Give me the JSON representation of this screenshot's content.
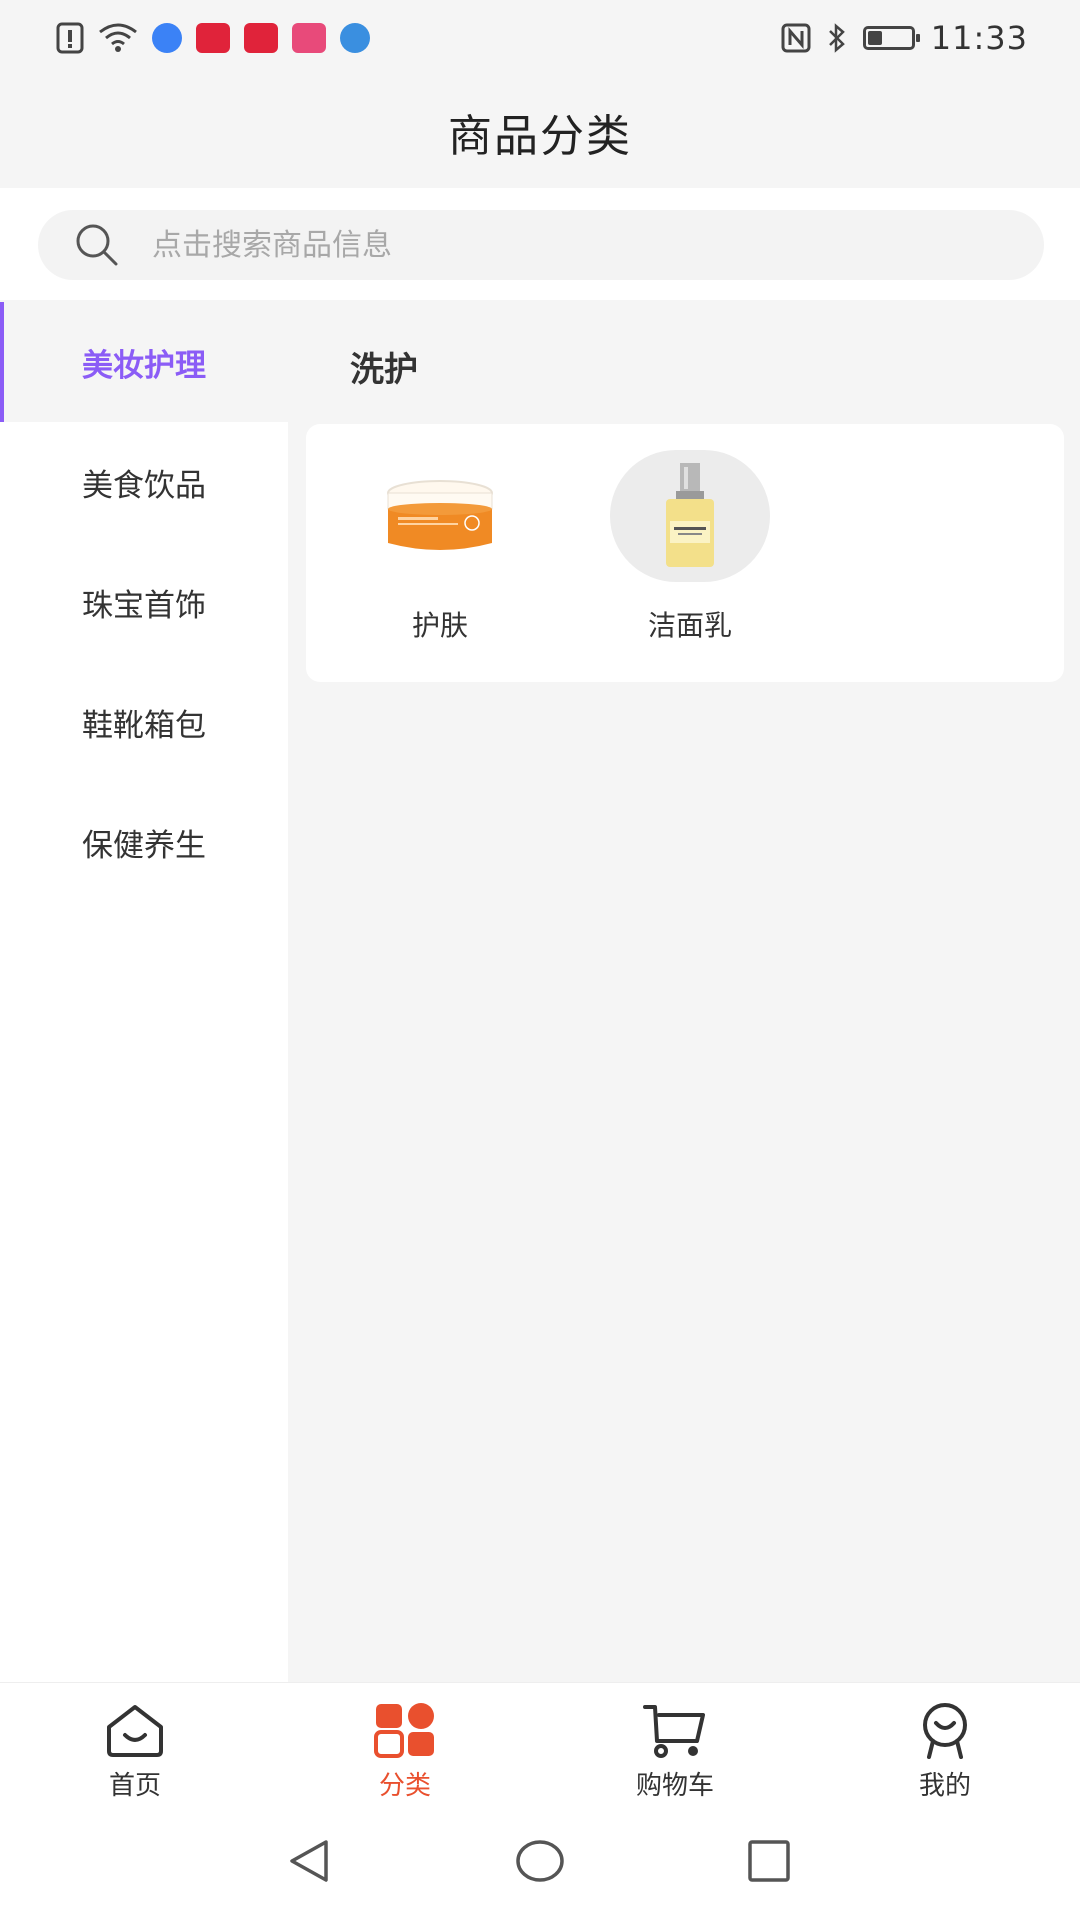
{
  "status_bar": {
    "time": "11:33",
    "battery_level": 0.35,
    "left_icons": [
      "alert-icon",
      "wifi-icon",
      "music-app-icon",
      "video-app-icon",
      "video-app-icon-2",
      "chat-app-icon",
      "browser-app-icon"
    ],
    "right_icons": [
      "nfc-icon",
      "bluetooth-icon",
      "battery-icon"
    ]
  },
  "header": {
    "title": "商品分类"
  },
  "search": {
    "placeholder": "点击搜索商品信息"
  },
  "categories": [
    {
      "label": "美妆护理",
      "active": true
    },
    {
      "label": "美食饮品",
      "active": false
    },
    {
      "label": "珠宝首饰",
      "active": false
    },
    {
      "label": "鞋靴箱包",
      "active": false
    },
    {
      "label": "保健养生",
      "active": false
    }
  ],
  "subcategory": {
    "title": "洗护",
    "products": [
      {
        "name": "护肤",
        "image": "orange-cream-jar"
      },
      {
        "name": "洁面乳",
        "image": "clinique-bottle"
      }
    ]
  },
  "bottom_nav": [
    {
      "label": "首页",
      "icon": "home-icon",
      "active": false
    },
    {
      "label": "分类",
      "icon": "category-icon",
      "active": true
    },
    {
      "label": "购物车",
      "icon": "cart-icon",
      "active": false
    },
    {
      "label": "我的",
      "icon": "profile-icon",
      "active": false
    }
  ],
  "colors": {
    "accent_purple": "#8b5cf6",
    "accent_red": "#e9502e"
  }
}
